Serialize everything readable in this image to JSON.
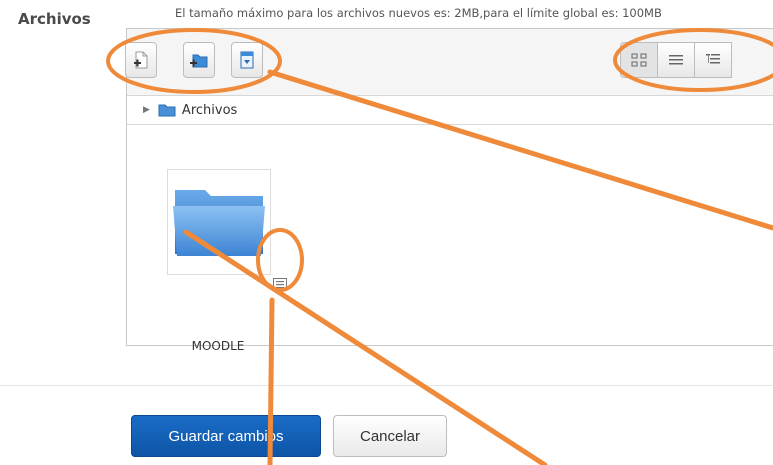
{
  "field": {
    "label": "Archivos",
    "maxsize_text": "El tamaño máximo para los archivos nuevos es: 2MB,para el límite global es: 100MB"
  },
  "toolbar": {
    "buttons": [
      {
        "name": "add-file",
        "icon": "file-add-icon"
      },
      {
        "name": "create-folder",
        "icon": "folder-add-icon"
      },
      {
        "name": "download-all",
        "icon": "download-icon"
      }
    ],
    "views": [
      {
        "name": "icons-view",
        "icon": "grid-icon",
        "selected": true
      },
      {
        "name": "list-view",
        "icon": "list-icon",
        "selected": false
      },
      {
        "name": "tree-view",
        "icon": "tree-icon",
        "selected": false
      }
    ]
  },
  "breadcrumb": {
    "folder": "Archivos"
  },
  "files": [
    {
      "name": "MOODLE",
      "type": "folder"
    }
  ],
  "actions": {
    "save_label": "Guardar cambios",
    "cancel_label": "Cancelar"
  },
  "colors": {
    "annotation": "#ee8a3a",
    "primary_button": "#1262b8",
    "folder": "#5aa0e6"
  }
}
